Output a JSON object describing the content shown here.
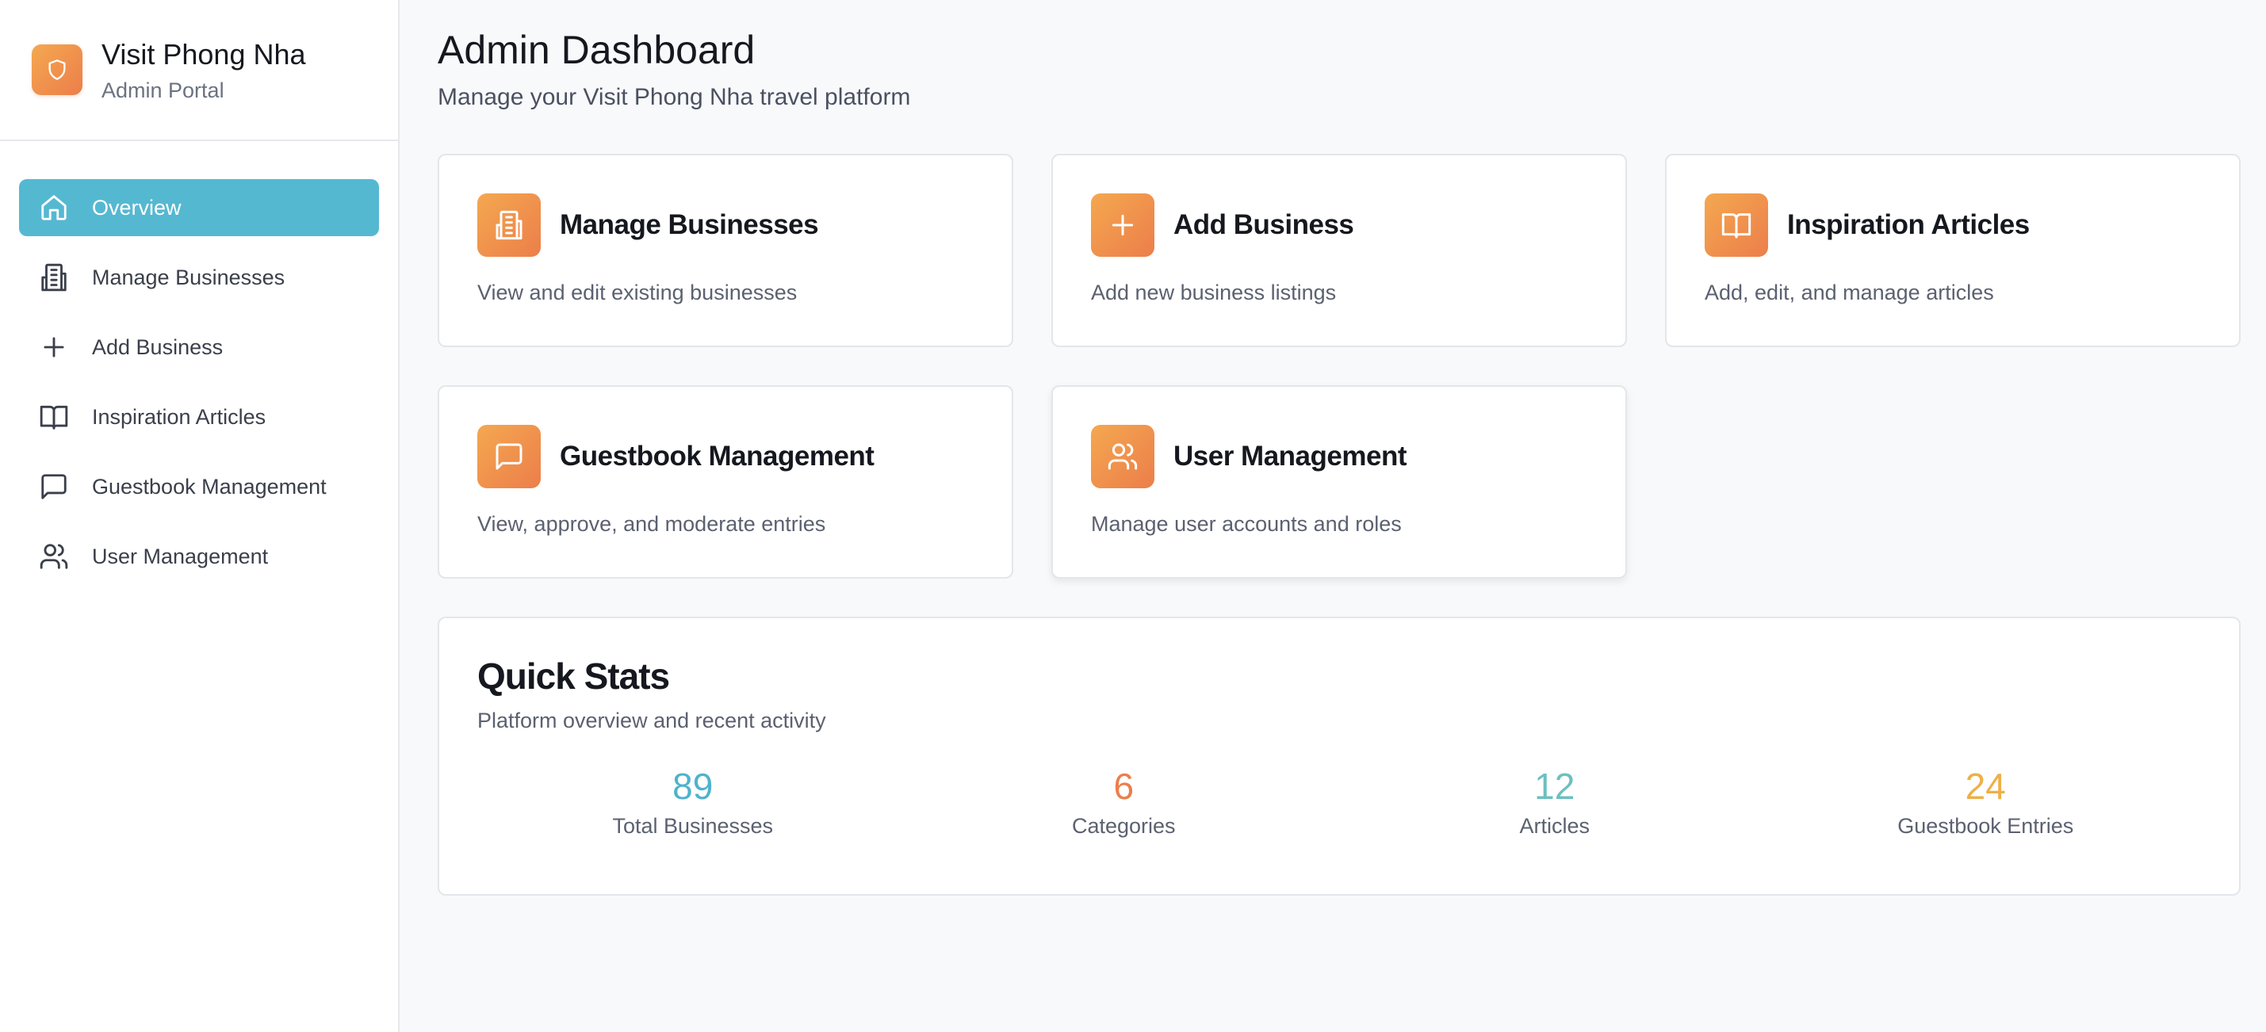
{
  "brand": {
    "title": "Visit Phong Nha",
    "subtitle": "Admin Portal",
    "icon": "shield-icon"
  },
  "sidebar": {
    "items": [
      {
        "label": "Overview",
        "icon": "home-icon",
        "active": true
      },
      {
        "label": "Manage Businesses",
        "icon": "building-icon",
        "active": false
      },
      {
        "label": "Add Business",
        "icon": "plus-icon",
        "active": false
      },
      {
        "label": "Inspiration Articles",
        "icon": "book-icon",
        "active": false
      },
      {
        "label": "Guestbook Management",
        "icon": "message-icon",
        "active": false
      },
      {
        "label": "User Management",
        "icon": "users-icon",
        "active": false
      }
    ]
  },
  "header": {
    "title": "Admin Dashboard",
    "subtitle": "Manage your Visit Phong Nha travel platform"
  },
  "cards": [
    {
      "title": "Manage Businesses",
      "description": "View and edit existing businesses",
      "icon": "building-icon"
    },
    {
      "title": "Add Business",
      "description": "Add new business listings",
      "icon": "plus-icon"
    },
    {
      "title": "Inspiration Articles",
      "description": "Add, edit, and manage articles",
      "icon": "book-icon"
    },
    {
      "title": "Guestbook Management",
      "description": "View, approve, and moderate entries",
      "icon": "message-icon"
    },
    {
      "title": "User Management",
      "description": "Manage user accounts and roles",
      "icon": "users-icon"
    }
  ],
  "quick_stats": {
    "title": "Quick Stats",
    "subtitle": "Platform overview and recent activity",
    "items": [
      {
        "value": "89",
        "label": "Total Businesses",
        "color": "#4fb3cc"
      },
      {
        "value": "6",
        "label": "Categories",
        "color": "#ec7e4a"
      },
      {
        "value": "12",
        "label": "Articles",
        "color": "#6ebfbf"
      },
      {
        "value": "24",
        "label": "Guestbook Entries",
        "color": "#eeb048"
      }
    ]
  },
  "colors": {
    "accent": "#55b8d1",
    "icon_gradient_start": "#f4a850",
    "icon_gradient_end": "#ec7e4a"
  }
}
